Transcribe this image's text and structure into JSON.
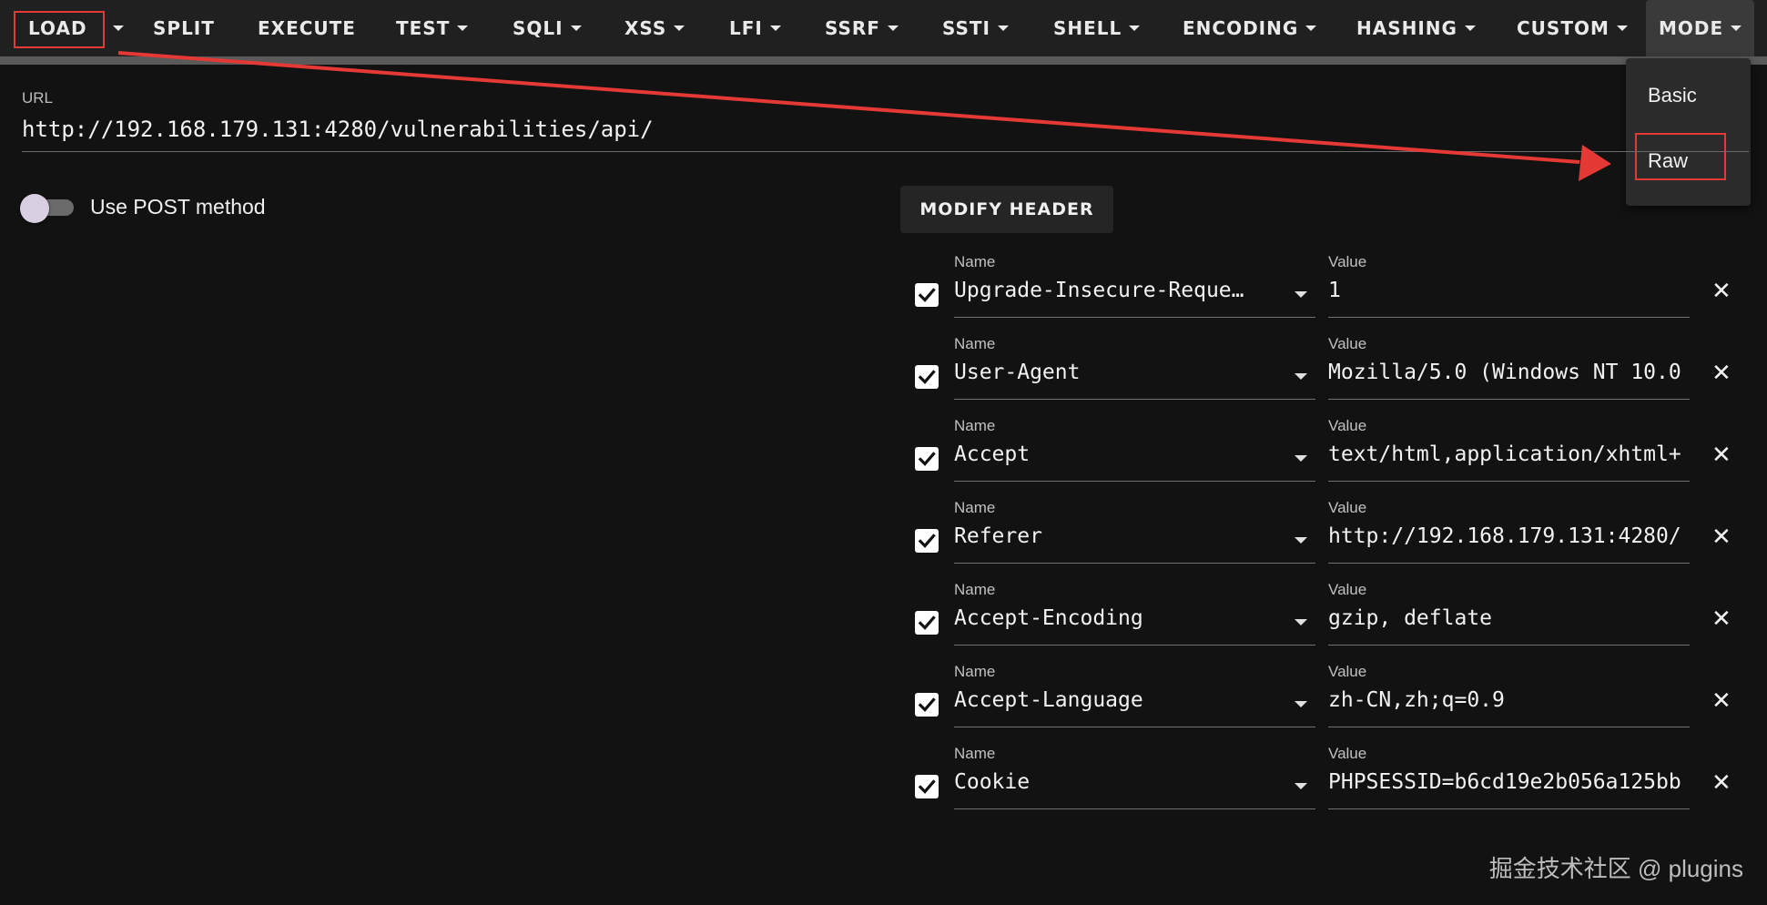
{
  "toolbar": {
    "items": [
      {
        "label": "LOAD",
        "caret": false
      },
      {
        "label": "",
        "caret": true
      },
      {
        "label": "SPLIT",
        "caret": false
      },
      {
        "label": "EXECUTE",
        "caret": false
      },
      {
        "label": "TEST",
        "caret": true
      },
      {
        "label": "SQLI",
        "caret": true
      },
      {
        "label": "XSS",
        "caret": true
      },
      {
        "label": "LFI",
        "caret": true
      },
      {
        "label": "SSRF",
        "caret": true
      },
      {
        "label": "SSTI",
        "caret": true
      },
      {
        "label": "SHELL",
        "caret": true
      },
      {
        "label": "ENCODING",
        "caret": true
      },
      {
        "label": "HASHING",
        "caret": true
      },
      {
        "label": "CUSTOM",
        "caret": true
      },
      {
        "label": "MODE",
        "caret": true
      }
    ]
  },
  "mode_menu": {
    "options": [
      "Basic",
      "Raw"
    ],
    "highlighted": "Raw"
  },
  "url": {
    "label": "URL",
    "value": "http://192.168.179.131:4280/vulnerabilities/api/"
  },
  "post_toggle": {
    "label": "Use POST method",
    "checked": false
  },
  "modify_header": {
    "button_label": "MODIFY HEADER",
    "name_label": "Name",
    "value_label": "Value",
    "rows": [
      {
        "name": "Upgrade-Insecure-Reque…",
        "value": "1",
        "checked": true
      },
      {
        "name": "User-Agent",
        "value": "Mozilla/5.0 (Windows NT 10.0",
        "checked": true
      },
      {
        "name": "Accept",
        "value": "text/html,application/xhtml+",
        "checked": true
      },
      {
        "name": "Referer",
        "value": "http://192.168.179.131:4280/",
        "checked": true
      },
      {
        "name": "Accept-Encoding",
        "value": "gzip, deflate",
        "checked": true
      },
      {
        "name": "Accept-Language",
        "value": "zh-CN,zh;q=0.9",
        "checked": true
      },
      {
        "name": "Cookie",
        "value": "PHPSESSID=b6cd19e2b056a125bb",
        "checked": true
      }
    ]
  },
  "watermark": "掘金技术社区 @ plugins",
  "colors": {
    "background": "#121212",
    "toolbar": "#202020",
    "annotation_red": "#e53935"
  }
}
